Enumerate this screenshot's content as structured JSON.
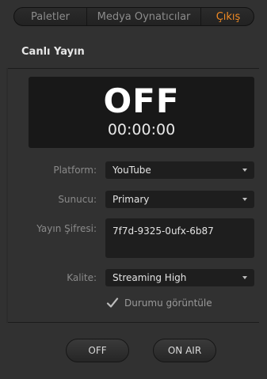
{
  "tabs": [
    {
      "label": "Paletler"
    },
    {
      "label": "Medya Oynatıcılar"
    },
    {
      "label": "Çıkış"
    }
  ],
  "active_tab_color": "#f08a24",
  "section": {
    "title": "Canlı Yayın"
  },
  "status": {
    "state": "OFF",
    "time": "00:00:00"
  },
  "fields": {
    "platform": {
      "label": "Platform:",
      "value": "YouTube"
    },
    "server": {
      "label": "Sunucu:",
      "value": "Primary"
    },
    "key": {
      "label": "Yayın Şifresi:",
      "value": "7f7d-9325-0ufx-6b87"
    },
    "quality": {
      "label": "Kalite:",
      "value": "Streaming High"
    }
  },
  "show_status": {
    "label": "Durumu görüntüle",
    "checked": true
  },
  "buttons": {
    "off": "OFF",
    "on_air": "ON AIR"
  }
}
